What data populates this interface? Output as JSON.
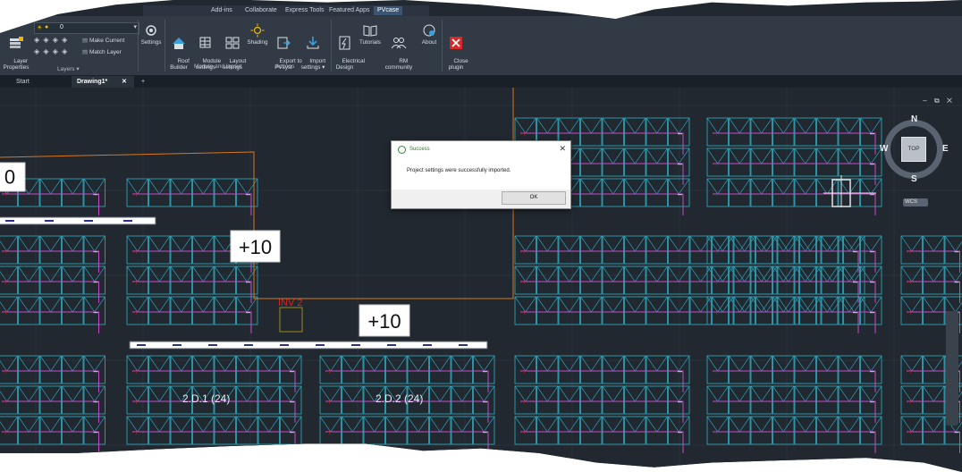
{
  "app_tabs": [
    "Add-ins",
    "Collaborate",
    "Express Tools",
    "Featured Apps",
    "PVcase"
  ],
  "active_tab": "PVcase",
  "layer_dropdown_value": "0",
  "ribbon": {
    "layer_properties": "Layer\nProperties",
    "make_current": "Make Current",
    "match_layer": "Match Layer",
    "layers_group": "Layers ▾",
    "settings": "Settings",
    "roof_builder": "Roof\nBuilder",
    "module_settings": "Module\nsettings",
    "layout_settings": "Layout\nsettings",
    "module_layout_group": "Module and layout",
    "shading": "Shading",
    "export_pvsyst": "Export to\nPVsyst",
    "import_settings": "Import\nsettings ▾",
    "actions_group": "Actions",
    "electrical_design": "Electrical\nDesign",
    "tutorials": "Tutorials",
    "rm_community": "RM\ncommunity",
    "about": "About",
    "close_plugin": "Close\nplugin"
  },
  "doc_tabs": {
    "start": "Start",
    "drawing": "Drawing1*",
    "close": "✕",
    "add": "+"
  },
  "viewport_controls": "– ⧉ ✕",
  "drawing": {
    "labels": [
      "+10",
      "+10",
      "0"
    ],
    "inverter": "INV 2",
    "strings": [
      "2.D.1  (24)",
      "2.D.2  (24)"
    ]
  },
  "viewcube": {
    "n": "N",
    "s": "S",
    "e": "E",
    "w": "W",
    "top": "TOP",
    "wcs": "WCS"
  },
  "dialog": {
    "title": "Success",
    "message": "Project settings were successfully imported.",
    "ok": "OK",
    "close": "✕"
  },
  "colors": {
    "module": "#2e9fb3",
    "magenta": "#c64bcc",
    "red": "#e02020",
    "orange": "#d8771f",
    "inverter": "#9a8a1a",
    "inv_text": "#e02020"
  }
}
